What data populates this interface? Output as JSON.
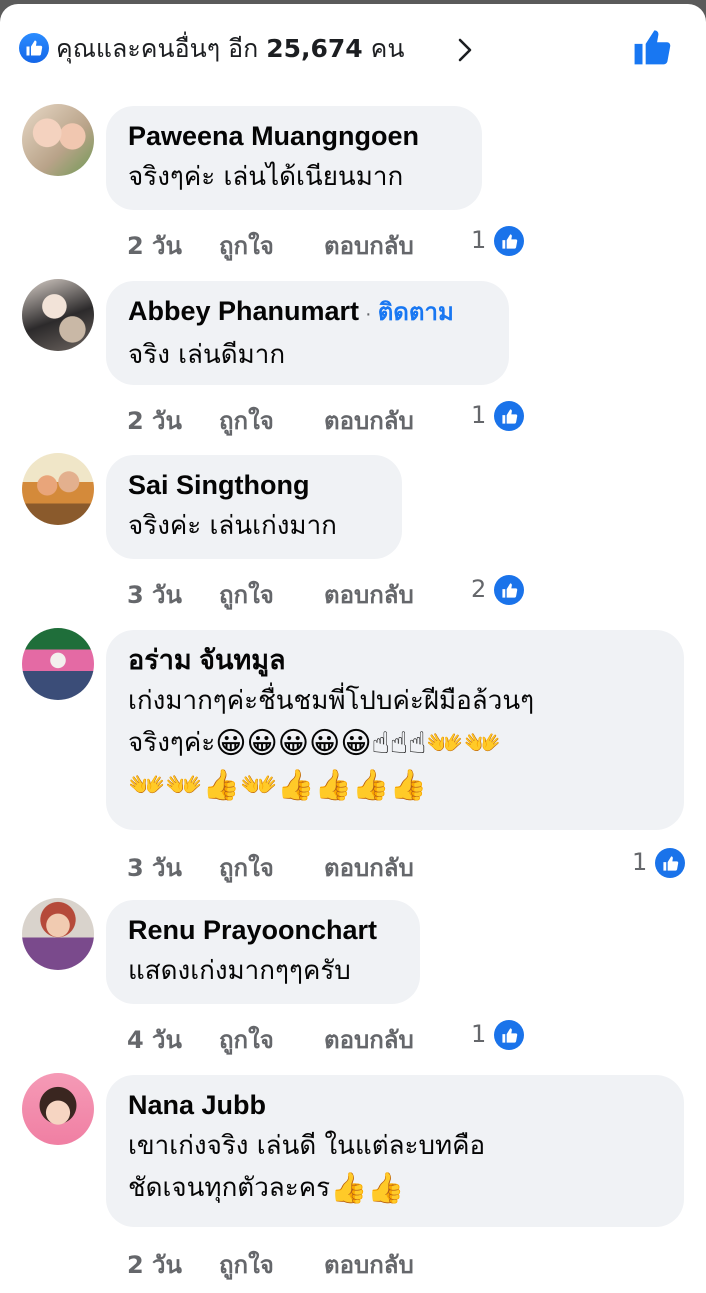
{
  "reactions": {
    "text": "คุณและคนอื่นๆ อีก",
    "count": "25,674",
    "unit": "คน",
    "like_icon": "like-icon",
    "chevron_icon": "chevron-right-icon"
  },
  "colors": {
    "accent": "#1877f2",
    "bubble": "#f0f2f5",
    "meta": "#65676b"
  },
  "comments": [
    {
      "author": "Paweena Muangngoen",
      "follow": "",
      "text": "จริงๆค่ะ เล่นได้เนียนมาก",
      "emoji": "",
      "time": "2 วัน",
      "like_label": "ถูกใจ",
      "reply_label": "ตอบกลับ",
      "reactions": "1"
    },
    {
      "author": "Abbey Phanumart",
      "follow": "ติดตาม",
      "text": "จริง เล่นดีมาก",
      "emoji": "",
      "time": "2 วัน",
      "like_label": "ถูกใจ",
      "reply_label": "ตอบกลับ",
      "reactions": "1"
    },
    {
      "author": "Sai Singthong",
      "follow": "",
      "text": "จริงค่ะ เล่นเก่งมาก",
      "emoji": "",
      "time": "3 วัน",
      "like_label": "ถูกใจ",
      "reply_label": "ตอบกลับ",
      "reactions": "2"
    },
    {
      "author": "อร่าม จันทมูล",
      "follow": "",
      "text_line1": "เก่งมากๆค่ะชื่นชมพี่โปบค่ะฝีมือล้วนๆ",
      "text_line2": "จริงๆค่ะ",
      "emoji_line2": "😀😀😀😀😀☝☝☝👐👐",
      "emoji_line3": "👐👐👍👐👍👍👍👍",
      "time": "3 วัน",
      "like_label": "ถูกใจ",
      "reply_label": "ตอบกลับ",
      "reactions": "1"
    },
    {
      "author": "Renu Prayoonchart",
      "follow": "",
      "text": "แสดงเก่งมากๆๆครับ",
      "emoji": "",
      "time": "4 วัน",
      "like_label": "ถูกใจ",
      "reply_label": "ตอบกลับ",
      "reactions": "1"
    },
    {
      "author": "Nana Jubb",
      "follow": "",
      "text_line1": "เขาเก่งจริง  เล่นดี ในแต่ละบทคือ",
      "text_line2": "ชัดเจนทุกตัวละคร",
      "emoji_line2": "👍👍",
      "time": "2 วัน",
      "like_label": "ถูกใจ",
      "reply_label": "ตอบกลับ",
      "reactions": ""
    }
  ]
}
